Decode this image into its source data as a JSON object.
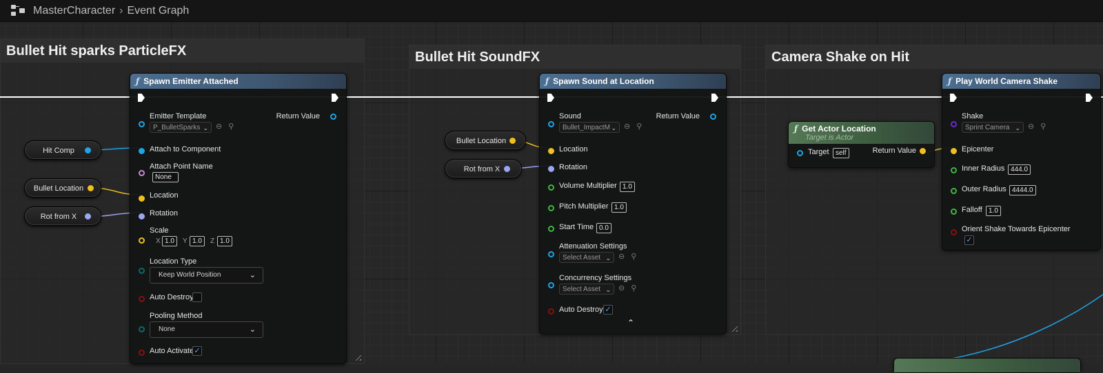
{
  "breadcrumb": {
    "root": "MasterCharacter",
    "current": "Event Graph"
  },
  "comments": {
    "particle": "Bullet Hit sparks ParticleFX",
    "sound": "Bullet Hit SoundFX",
    "camera": "Camera Shake on Hit"
  },
  "reroutes": {
    "hit_comp": "Hit Comp",
    "bullet_location_1": "Bullet Location",
    "rot_from_x_1": "Rot from X",
    "bullet_location_2": "Bullet Location",
    "rot_from_x_2": "Rot from X"
  },
  "spawn_emitter": {
    "title": "Spawn Emitter Attached",
    "emitter_template": "Emitter Template",
    "emitter_value": "P_BulletSparks",
    "return_value": "Return Value",
    "attach_to_component": "Attach to Component",
    "attach_point_name": "Attach Point Name",
    "attach_point_value": "None",
    "location": "Location",
    "rotation": "Rotation",
    "scale": "Scale",
    "scale_x_label": "X",
    "scale_x": "1.0",
    "scale_y_label": "Y",
    "scale_y": "1.0",
    "scale_z_label": "Z",
    "scale_z": "1.0",
    "location_type": "Location Type",
    "location_type_value": "Keep World Position",
    "auto_destroy": "Auto Destroy",
    "pooling_method": "Pooling Method",
    "pooling_value": "None",
    "auto_activate": "Auto Activate"
  },
  "spawn_sound": {
    "title": "Spawn Sound at Location",
    "sound": "Sound",
    "sound_value": "Bullet_ImpactM",
    "return_value": "Return Value",
    "location": "Location",
    "rotation": "Rotation",
    "volume_multiplier": "Volume Multiplier",
    "volume_value": "1.0",
    "pitch_multiplier": "Pitch Multiplier",
    "pitch_value": "1.0",
    "start_time": "Start Time",
    "start_time_value": "0.0",
    "attenuation_settings": "Attenuation Settings",
    "attenuation_value": "Select Asset",
    "concurrency_settings": "Concurrency Settings",
    "concurrency_value": "Select Asset",
    "auto_destroy": "Auto Destroy"
  },
  "get_actor_location": {
    "title": "Get Actor Location",
    "subtitle": "Target is Actor",
    "target": "Target",
    "target_value": "self",
    "return_value": "Return Value"
  },
  "camera_shake": {
    "title": "Play World Camera Shake",
    "shake": "Shake",
    "shake_value": "Sprint Camera",
    "epicenter": "Epicenter",
    "inner_radius": "Inner Radius",
    "inner_radius_value": "444.0",
    "outer_radius": "Outer Radius",
    "outer_radius_value": "4444.0",
    "falloff": "Falloff",
    "falloff_value": "1.0",
    "orient_shake": "Orient Shake Towards Epicenter"
  },
  "colors": {
    "object_pin": "#1ea5e8",
    "vector_pin": "#f0c020",
    "rotator_pin": "#9aa6f0",
    "float_pin": "#3fb83f",
    "name_pin": "#c58cd8",
    "bool_pin": "#8c0e0e",
    "class_pin": "#6a2bd1",
    "enum_pin": "#0a6a6a"
  }
}
